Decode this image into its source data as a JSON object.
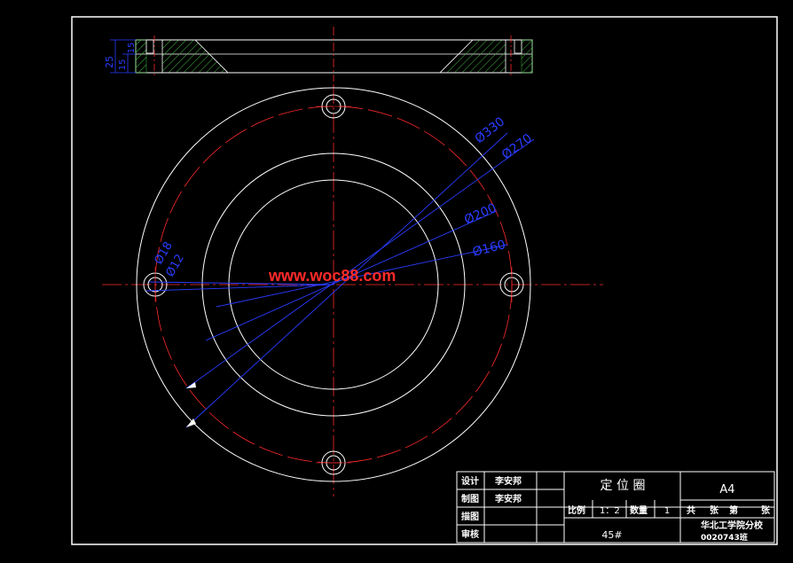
{
  "drawing": {
    "watermark": "www.woc88.com",
    "section_dims": [
      "25",
      "15",
      "15"
    ],
    "dimensions": {
      "d330": "Ø330",
      "d270": "Ø270",
      "d200": "Ø200",
      "d160": "Ø160",
      "d18": "Ø18",
      "d12": "Ø12"
    }
  },
  "title_block": {
    "labels": {
      "design": "设计",
      "draw": "制图",
      "trace": "描图",
      "review": "审核",
      "scale": "比例",
      "quantity": "数量",
      "total": "共",
      "sheets": "张",
      "sheet_no": "第",
      "sheet_unit": "张"
    },
    "values": {
      "designer": "李安邦",
      "drafter": "李安邦",
      "scale": "1：2",
      "quantity": "1"
    },
    "part_name": "定 位 圈",
    "paper_size": "A4",
    "material": "45#",
    "school": "华北工学院分校",
    "class_code": "0020743班"
  },
  "colors": {
    "outline": "#ffffff",
    "centerline": "#ff2a2a",
    "dimension": "#2a3cff",
    "hatch": "#3fbf3f"
  }
}
